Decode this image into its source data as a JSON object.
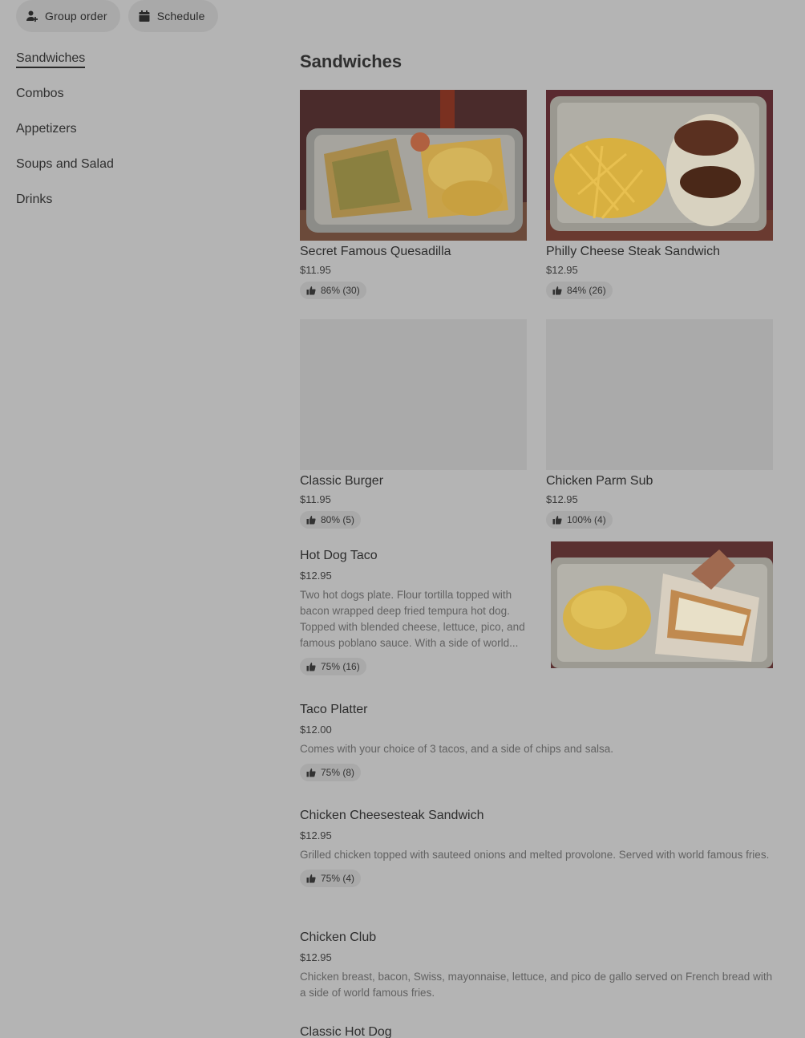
{
  "topbar": {
    "group_order": "Group order",
    "schedule": "Schedule"
  },
  "sidenav": {
    "items": [
      {
        "label": "Sandwiches",
        "active": true
      },
      {
        "label": "Combos"
      },
      {
        "label": "Appetizers"
      },
      {
        "label": "Soups and Salad"
      },
      {
        "label": "Drinks"
      }
    ]
  },
  "section": {
    "title": "Sandwiches"
  },
  "cards": [
    {
      "name": "Secret Famous Quesadilla",
      "price": "$11.95",
      "rating": "86% (30)",
      "image": "quesadilla-photo"
    },
    {
      "name": "Philly Cheese Steak Sandwich",
      "price": "$12.95",
      "rating": "84% (26)",
      "image": "philly-photo"
    },
    {
      "name": "Classic Burger",
      "price": "$11.95",
      "rating": "80% (5)",
      "image": "placeholder"
    },
    {
      "name": "Chicken Parm Sub",
      "price": "$12.95",
      "rating": "100% (4)",
      "image": "placeholder"
    }
  ],
  "list_items": [
    {
      "name": "Hot Dog Taco",
      "price": "$12.95",
      "desc": "Two hot dogs plate. Flour tortilla topped with bacon wrapped deep fried tempura hot dog. Topped with blended cheese, lettuce, pico, and famous poblano sauce. With a side of world...",
      "rating": "75% (16)"
    },
    {
      "name": "Taco Platter",
      "price": "$12.00",
      "desc": "Comes with your choice of 3 tacos, and a side of chips and salsa.",
      "rating": "75% (8)"
    },
    {
      "name": "Chicken Cheesesteak Sandwich",
      "price": "$12.95",
      "desc": "Grilled chicken topped with sauteed onions and melted provolone. Served with world famous fries.",
      "rating": "75% (4)"
    },
    {
      "name": "Chicken Club",
      "price": "$12.95",
      "desc": "Chicken breast, bacon, Swiss, mayonnaise, lettuce, and pico de gallo served on French bread with a side of world famous fries."
    },
    {
      "name": "Classic Hot Dog"
    }
  ],
  "colors": {
    "overlay_bg": "#b4b4b4",
    "pill_bg": "#a9a9a9"
  },
  "icons": {
    "group_order": "person-add-icon",
    "schedule": "calendar-icon",
    "rating": "thumbs-up-icon"
  }
}
